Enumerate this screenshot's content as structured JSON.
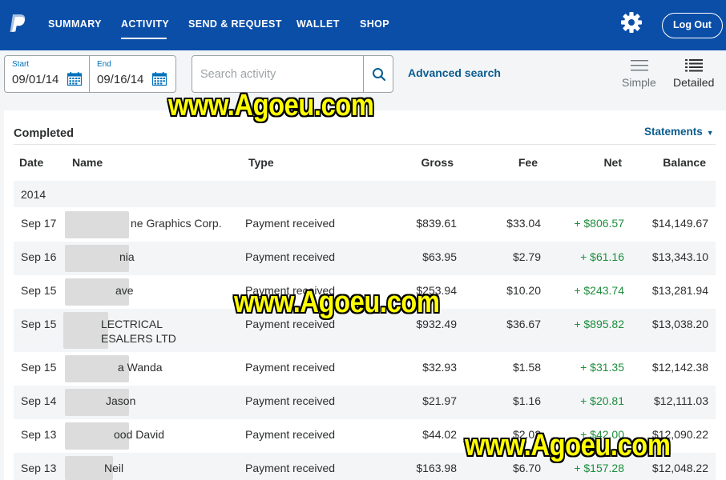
{
  "nav": {
    "items": [
      {
        "label": "SUMMARY"
      },
      {
        "label": "ACTIVITY"
      },
      {
        "label": "SEND & REQUEST"
      },
      {
        "label": "WALLET"
      },
      {
        "label": "SHOP"
      }
    ],
    "active": "ACTIVITY",
    "logout_label": "Log Out",
    "brand_color": "#0b4ea8"
  },
  "filters": {
    "start_label": "Start",
    "start_value": "09/01/14",
    "end_label": "End",
    "end_value": "09/16/14",
    "search_placeholder": "Search activity",
    "advanced_search_label": "Advanced search",
    "view_simple_label": "Simple",
    "view_detailed_label": "Detailed"
  },
  "activity": {
    "section_title": "Completed",
    "statements_label": "Statements",
    "columns": [
      "Date",
      "Name",
      "Type",
      "Gross",
      "Fee",
      "Net",
      "Balance"
    ],
    "year": "2014",
    "net_color": "#1f8e3e",
    "rows": [
      {
        "date": "Sep 17",
        "name": "ne Graphics Corp.",
        "name2": "",
        "type": "Payment received",
        "gross": "$839.61",
        "fee": "$33.04",
        "net": "+ $806.57",
        "balance": "$14,149.67"
      },
      {
        "date": "Sep 16",
        "name": "nia",
        "name2": "",
        "type": "Payment received",
        "gross": "$63.95",
        "fee": "$2.79",
        "net": "+ $61.16",
        "balance": "$13,343.10"
      },
      {
        "date": "Sep 15",
        "name": "ave",
        "name2": "",
        "type": "Payment received",
        "gross": "$253.94",
        "fee": "$10.20",
        "net": "+ $243.74",
        "balance": "$13,281.94"
      },
      {
        "date": "Sep 15",
        "name": "LECTRICAL",
        "name2": "ESALERS LTD",
        "type": "Payment received",
        "gross": "$932.49",
        "fee": "$36.67",
        "net": "+ $895.82",
        "balance": "$13,038.20"
      },
      {
        "date": "Sep 15",
        "name": "a Wanda",
        "name2": "",
        "type": "Payment received",
        "gross": "$32.93",
        "fee": "$1.58",
        "net": "+ $31.35",
        "balance": "$12,142.38"
      },
      {
        "date": "Sep 14",
        "name": "Jason",
        "name2": "",
        "type": "Payment received",
        "gross": "$21.97",
        "fee": "$1.16",
        "net": "+ $20.81",
        "balance": "$12,111.03"
      },
      {
        "date": "Sep 13",
        "name": "ood David",
        "name2": "",
        "type": "Payment received",
        "gross": "$44.02",
        "fee": "$2.02",
        "net": "+ $42.00",
        "balance": "$12,090.22"
      },
      {
        "date": "Sep 13",
        "name": "Neil",
        "name2": "",
        "type": "Payment received",
        "gross": "$163.98",
        "fee": "$6.70",
        "net": "+ $157.28",
        "balance": "$12,048.22"
      }
    ]
  },
  "watermark": "www.Agoeu.com"
}
